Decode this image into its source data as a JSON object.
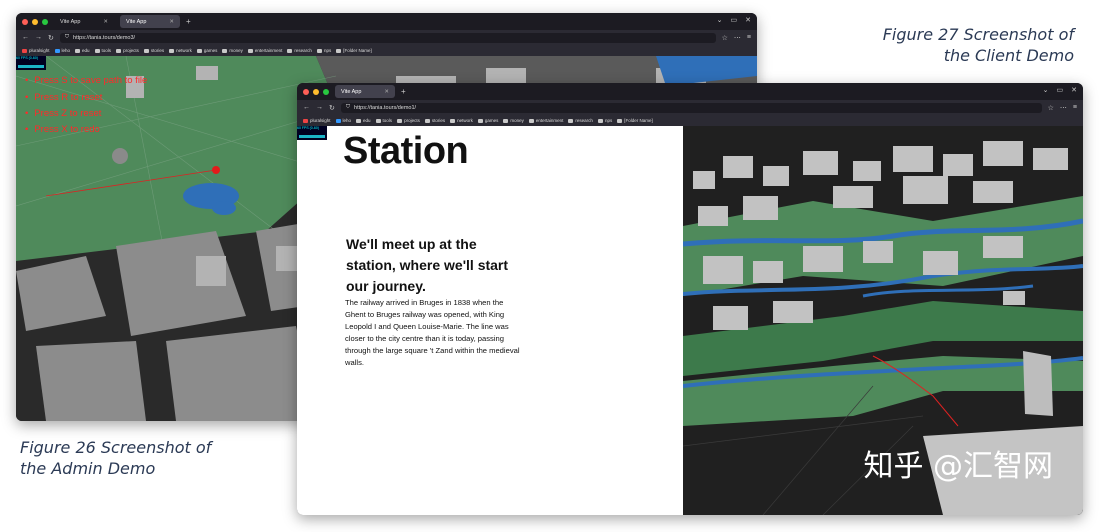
{
  "captions": {
    "client": [
      "Figure 27 Screenshot of",
      "the Client Demo"
    ],
    "admin": [
      "Figure 26 Screenshot of",
      "the Admin Demo"
    ]
  },
  "colors": {
    "traffic_red": "#ff5f57",
    "traffic_yellow": "#febc2e",
    "traffic_green": "#28c840",
    "hint_red": "#ff2a2a"
  },
  "admin_window": {
    "tabs": [
      "Vite App",
      "Vite App"
    ],
    "url": "https://tania.tours/demo3/",
    "bookmarks": [
      "pluralsight",
      "leho",
      "edu",
      "tools",
      "projects",
      "stories",
      "network",
      "games",
      "money",
      "entertainment",
      "research",
      "nps",
      "[Folder Name]"
    ],
    "fps": "60 FPS (0-60)",
    "hints": [
      "Press S to save path to file",
      "Press R to reset",
      "Press Z to reset",
      "Press X to redo"
    ]
  },
  "client_window": {
    "tabs": [
      "Vite App"
    ],
    "url": "https://tania.tours/demo1/",
    "bookmarks": [
      "pluralsight",
      "leho",
      "edu",
      "tools",
      "projects",
      "stories",
      "network",
      "games",
      "money",
      "entertainment",
      "research",
      "nps",
      "[Folder Name]"
    ],
    "fps": "60 FPS (0-60)",
    "title": "Station",
    "subheading": "We'll meet up at the station, where we'll start our journey.",
    "paragraph": "The railway arrived in Bruges in 1838 when the Ghent to Bruges railway was opened, with King Leopold I and Queen Louise-Marie. The line was closer to the city centre than it is today, passing through the large square 't Zand within the medieval walls."
  },
  "watermark": "知乎 @汇智网"
}
